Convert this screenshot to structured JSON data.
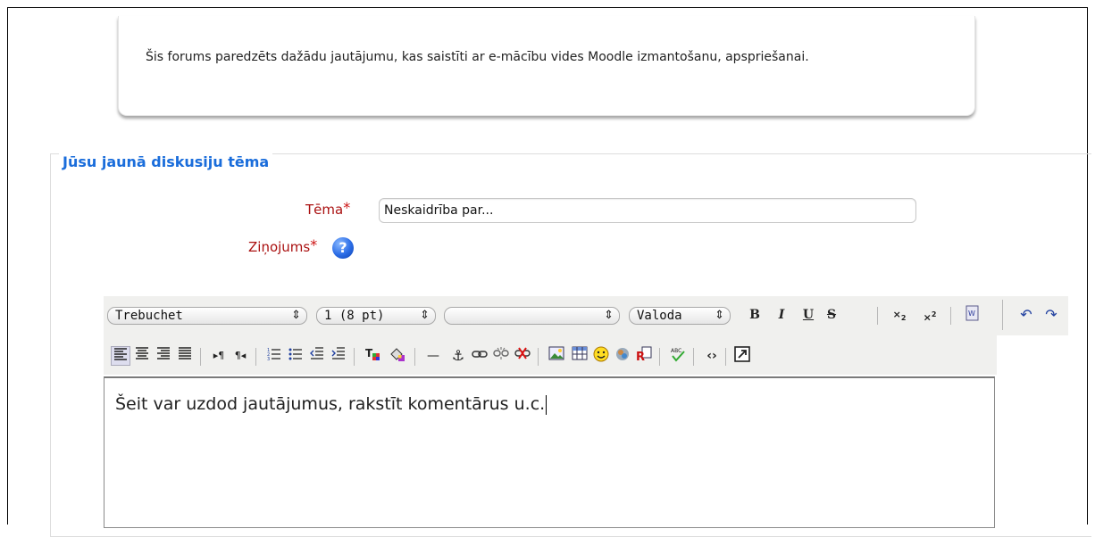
{
  "intro": {
    "text": "Šis forums paredzēts dažādu jautājumu, kas saistīti ar e-mācību vides Moodle izmantošanu, apspriešanai."
  },
  "form": {
    "legend": "Jūsu jaunā diskusiju tēma",
    "subject_label": "Tēma",
    "subject_value": "Neskaidrība par...",
    "message_label": "Ziņojums",
    "required_marker": "*",
    "help_glyph": "?"
  },
  "toolbar": {
    "font_family": "Trebuchet",
    "font_size": "1 (8 pt)",
    "heading": "",
    "language": "Valoda",
    "arrow_glyph": "⇕"
  },
  "editor": {
    "content": "Šeit var uzdod jautājumus, rakstīt komentārus u.c."
  },
  "colors": {
    "legend": "#1a6ddb",
    "label": "#aa1111",
    "required": "#cc1111"
  },
  "icons": [
    "bold-icon",
    "italic-icon",
    "underline-icon",
    "strikethrough-icon",
    "subscript-icon",
    "superscript-icon",
    "paste-word-icon",
    "undo-icon",
    "redo-icon",
    "align-left-icon",
    "align-center-icon",
    "align-right-icon",
    "justify-icon",
    "ltr-icon",
    "rtl-icon",
    "ordered-list-icon",
    "unordered-list-icon",
    "outdent-icon",
    "indent-icon",
    "text-color-icon",
    "background-color-icon",
    "horizontal-rule-icon",
    "anchor-icon",
    "link-icon",
    "unlink-icon",
    "nolink-icon",
    "image-icon",
    "table-icon",
    "smiley-icon",
    "insert-char-icon",
    "search-replace-icon",
    "spellcheck-icon",
    "html-source-icon",
    "fullscreen-icon"
  ]
}
